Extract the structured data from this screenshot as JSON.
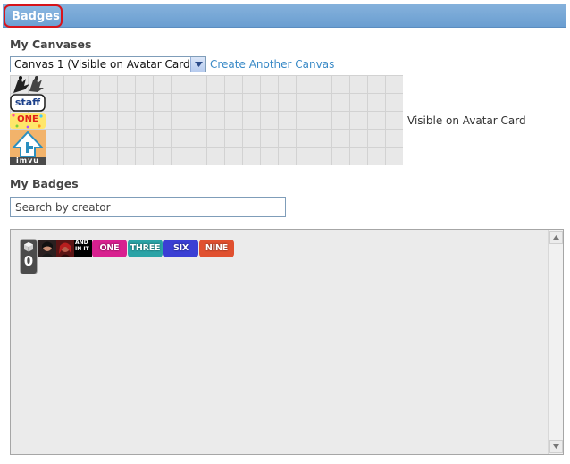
{
  "header": {
    "title": "Badges"
  },
  "canvases": {
    "heading": "My Canvases",
    "selected": "Canvas 1 (Visible on Avatar Card)",
    "create_link": "Create Another Canvas",
    "visible_label": "Visible on Avatar Card",
    "grid_badges": [
      {
        "name": "silhouette-badge"
      },
      {
        "name": "staff-badge",
        "text": "staff"
      },
      {
        "name": "one-badge",
        "text": "ONE"
      },
      {
        "name": "imvu-badge",
        "text": "imvu"
      }
    ]
  },
  "badges": {
    "heading": "My Badges",
    "search": {
      "placeholder": "Search by creator",
      "value": "Search by creator"
    },
    "count": "0",
    "photo_badge_text": "AND IN IT",
    "strips": [
      {
        "label": "ONE",
        "color": "#d8208f"
      },
      {
        "label": "THREE",
        "color": "#2aa3a6"
      },
      {
        "label": "SIX",
        "color": "#3a3fd4"
      },
      {
        "label": "NINE",
        "color": "#e0502f"
      }
    ]
  }
}
